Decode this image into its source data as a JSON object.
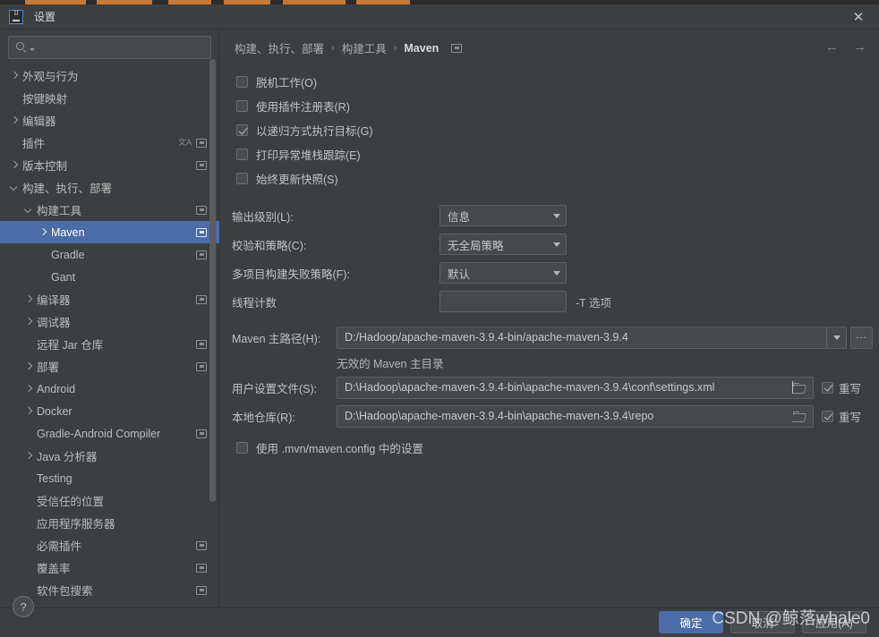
{
  "window": {
    "title": "设置",
    "logo_text": "IJ",
    "close_label": "✕"
  },
  "sidebar": {
    "search_placeholder": "",
    "search_value": "",
    "items": [
      {
        "label": "外观与行为",
        "arrow": "right",
        "indent": 0,
        "badge": "",
        "selected": false
      },
      {
        "label": "按键映射",
        "arrow": "none",
        "indent": 0,
        "badge": "",
        "selected": false
      },
      {
        "label": "编辑器",
        "arrow": "right",
        "indent": 0,
        "badge": "",
        "selected": false
      },
      {
        "label": "插件",
        "arrow": "none",
        "indent": 0,
        "badge": "sync",
        "translate": true,
        "selected": false
      },
      {
        "label": "版本控制",
        "arrow": "right",
        "indent": 0,
        "badge": "sync",
        "selected": false
      },
      {
        "label": "构建、执行、部署",
        "arrow": "down",
        "indent": 0,
        "badge": "",
        "selected": false
      },
      {
        "label": "构建工具",
        "arrow": "down",
        "indent": 1,
        "badge": "sync",
        "selected": false
      },
      {
        "label": "Maven",
        "arrow": "right",
        "indent": 2,
        "badge": "sync",
        "selected": true
      },
      {
        "label": "Gradle",
        "arrow": "none",
        "indent": 2,
        "badge": "sync",
        "selected": false
      },
      {
        "label": "Gant",
        "arrow": "none",
        "indent": 2,
        "badge": "",
        "selected": false
      },
      {
        "label": "编译器",
        "arrow": "right",
        "indent": 1,
        "badge": "sync",
        "selected": false
      },
      {
        "label": "调试器",
        "arrow": "right",
        "indent": 1,
        "badge": "",
        "selected": false
      },
      {
        "label": "远程 Jar 仓库",
        "arrow": "none",
        "indent": 1,
        "badge": "sync",
        "selected": false
      },
      {
        "label": "部署",
        "arrow": "right",
        "indent": 1,
        "badge": "sync",
        "selected": false
      },
      {
        "label": "Android",
        "arrow": "right",
        "indent": 1,
        "badge": "",
        "selected": false
      },
      {
        "label": "Docker",
        "arrow": "right",
        "indent": 1,
        "badge": "",
        "selected": false
      },
      {
        "label": "Gradle-Android Compiler",
        "arrow": "none",
        "indent": 1,
        "badge": "sync",
        "selected": false
      },
      {
        "label": "Java 分析器",
        "arrow": "right",
        "indent": 1,
        "badge": "",
        "selected": false
      },
      {
        "label": "Testing",
        "arrow": "none",
        "indent": 1,
        "badge": "",
        "selected": false
      },
      {
        "label": "受信任的位置",
        "arrow": "none",
        "indent": 1,
        "badge": "",
        "selected": false
      },
      {
        "label": "应用程序服务器",
        "arrow": "none",
        "indent": 1,
        "badge": "",
        "selected": false
      },
      {
        "label": "必需插件",
        "arrow": "none",
        "indent": 1,
        "badge": "sync",
        "selected": false
      },
      {
        "label": "覆盖率",
        "arrow": "none",
        "indent": 1,
        "badge": "sync",
        "selected": false
      },
      {
        "label": "软件包搜索",
        "arrow": "none",
        "indent": 1,
        "badge": "sync",
        "selected": false
      }
    ]
  },
  "breadcrumb": {
    "crumbs": [
      "构建、执行、部署",
      "构建工具",
      "Maven"
    ],
    "separator": "›",
    "back_arrow": "←",
    "forward_arrow": "→"
  },
  "main": {
    "checkboxes": [
      {
        "label": "脱机工作(O)",
        "checked": false
      },
      {
        "label": "使用插件注册表(R)",
        "checked": false
      },
      {
        "label": "以递归方式执行目标(G)",
        "checked": true
      },
      {
        "label": "打印异常堆栈跟踪(E)",
        "checked": false
      },
      {
        "label": "始终更新快照(S)",
        "checked": false
      }
    ],
    "combos": [
      {
        "label": "输出级别(L):",
        "value": "信息"
      },
      {
        "label": "校验和策略(C):",
        "value": "无全局策略"
      },
      {
        "label": "多项目构建失败策略(F):",
        "value": "默认"
      }
    ],
    "thread_count": {
      "label": "线程计数",
      "value": "",
      "hint": "-T 选项"
    },
    "maven_home": {
      "label": "Maven 主路径(H):",
      "value": "D:/Hadoop/apache-maven-3.9.4-bin/apache-maven-3.9.4",
      "ellipsis_label": "...",
      "error": "无效的 Maven 主目录"
    },
    "user_settings": {
      "label": "用户设置文件(S):",
      "value": "D:\\Hadoop\\apache-maven-3.9.4-bin\\apache-maven-3.9.4\\conf\\settings.xml",
      "override_label": "重写",
      "override_checked": true
    },
    "local_repo": {
      "label": "本地仓库(R):",
      "value": "D:\\Hadoop\\apache-maven-3.9.4-bin\\apache-maven-3.9.4\\repo",
      "override_label": "重写",
      "override_checked": true
    },
    "mvn_config": {
      "label": "使用 .mvn/maven.config 中的设置",
      "checked": false
    }
  },
  "footer": {
    "help_label": "?",
    "ok_label": "确定",
    "cancel_label": "取消",
    "apply_label": "应用(A)"
  },
  "watermark": {
    "text": "CSDN @鲸落whale0"
  },
  "colors": {
    "background": "#3c3f41",
    "selection": "#4a6da7",
    "field": "#45494a",
    "border": "#5e6060",
    "text": "#c0c3c5"
  }
}
